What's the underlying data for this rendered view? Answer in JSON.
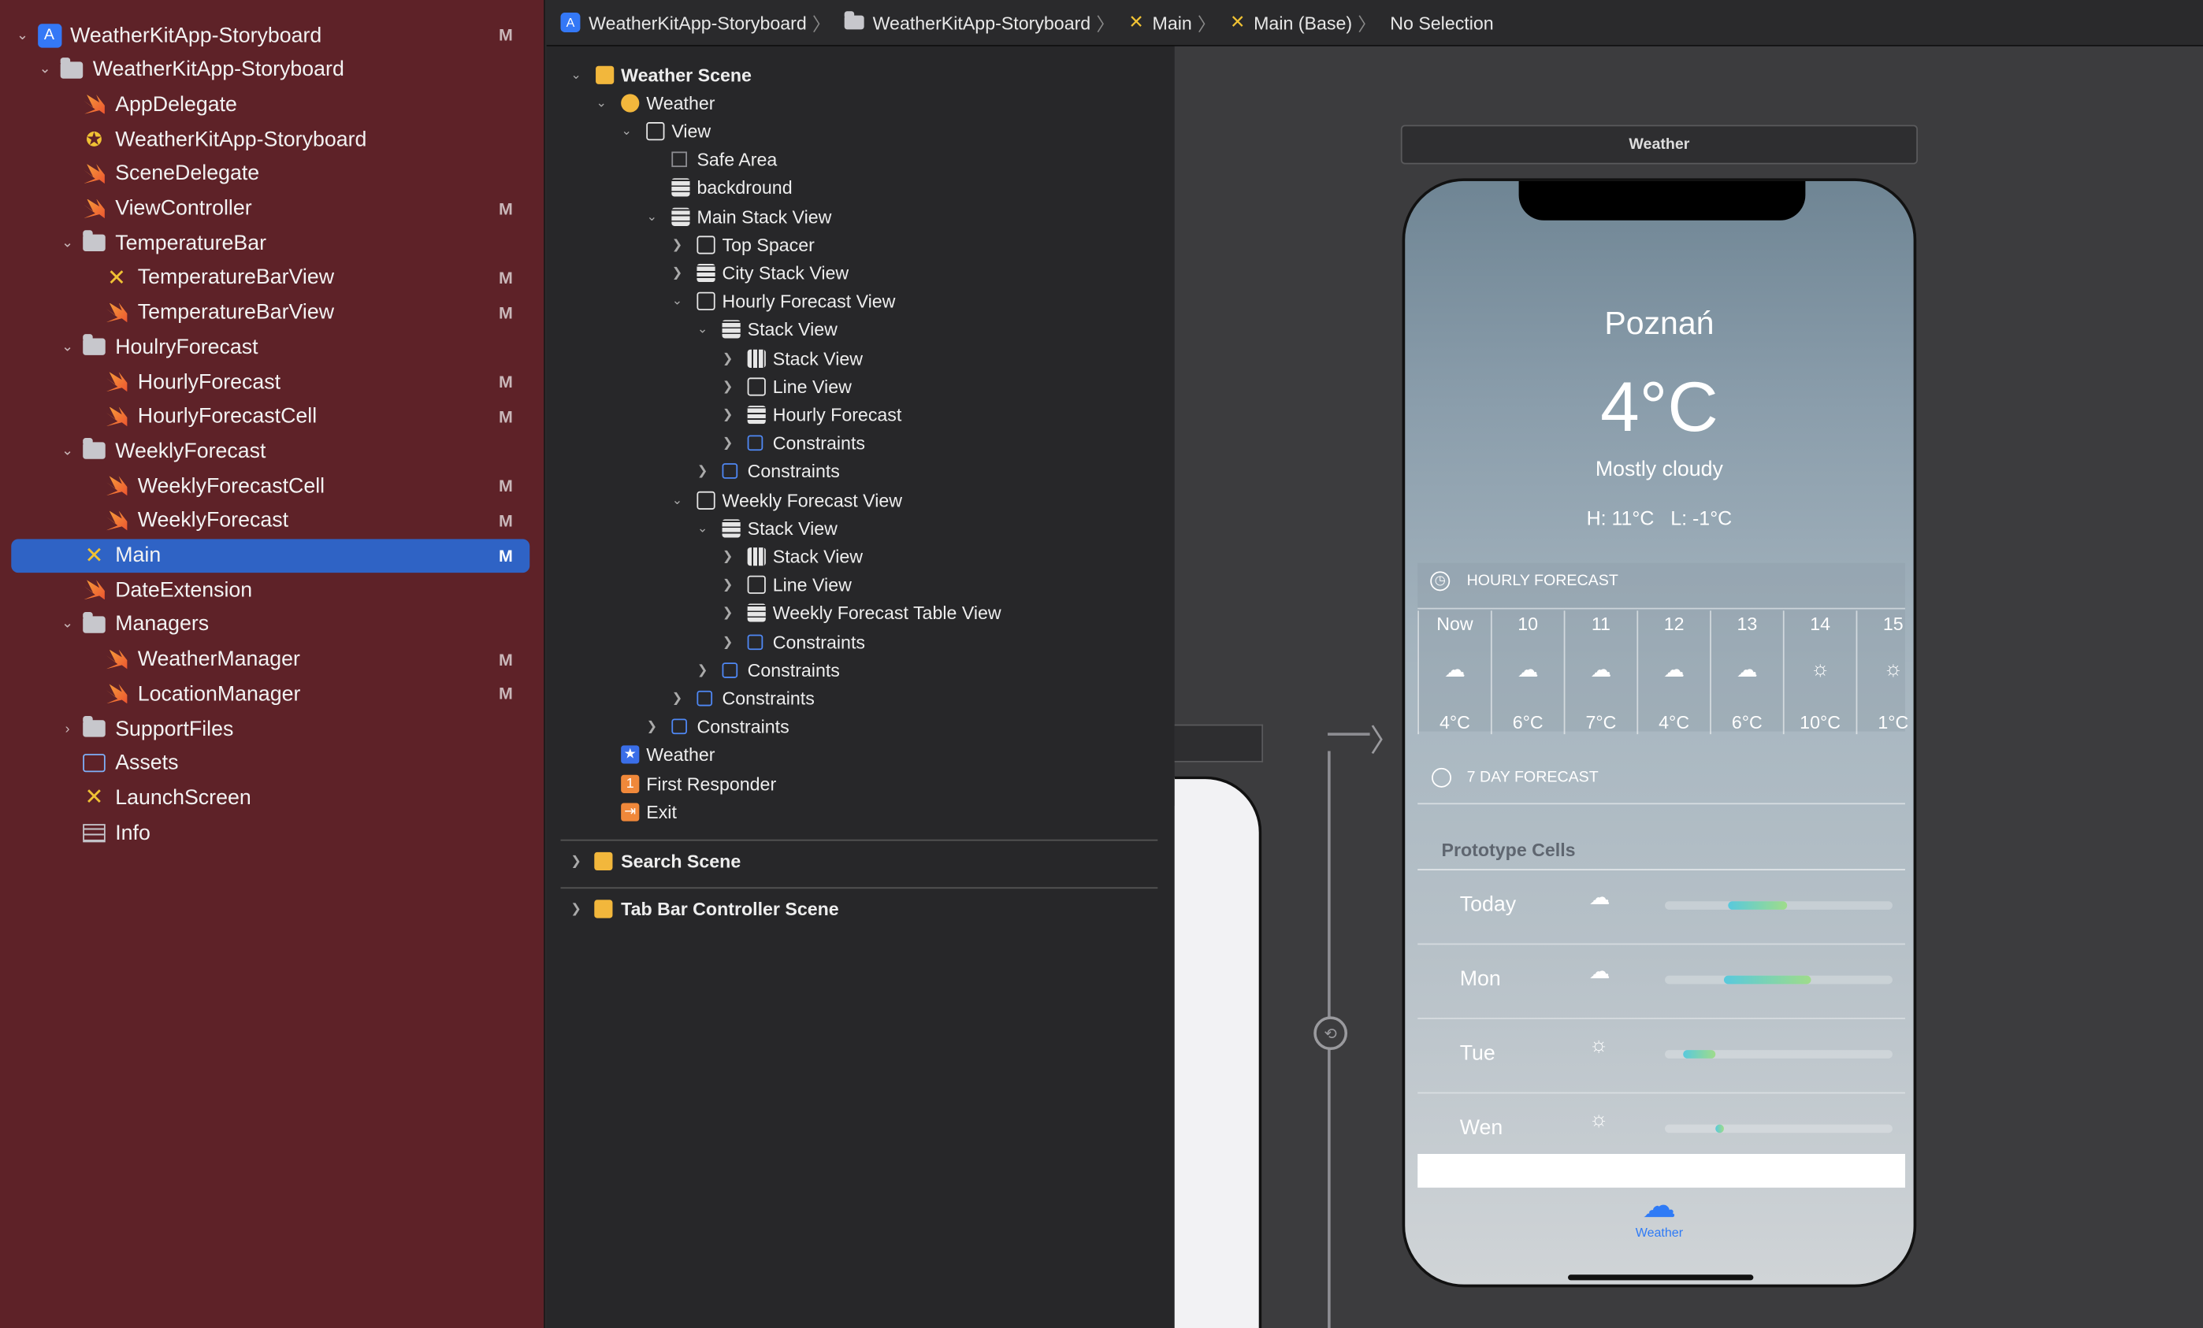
{
  "navigator": {
    "items": [
      {
        "label": "WeatherKitApp-Storyboard",
        "badge": "M",
        "icon": "project-icon"
      },
      {
        "label": "WeatherKitApp-Storyboard",
        "badge": "",
        "icon": "folder-icon"
      },
      {
        "label": "AppDelegate",
        "badge": "",
        "icon": "swift-file-icon"
      },
      {
        "label": "WeatherKitApp-Storyboard",
        "badge": "",
        "icon": "entitlements-icon"
      },
      {
        "label": "SceneDelegate",
        "badge": "",
        "icon": "swift-file-icon"
      },
      {
        "label": "ViewController",
        "badge": "M",
        "icon": "swift-file-icon"
      },
      {
        "label": "TemperatureBar",
        "badge": "",
        "icon": "folder-icon"
      },
      {
        "label": "TemperatureBarView",
        "badge": "M",
        "icon": "xib-icon"
      },
      {
        "label": "TemperatureBarView",
        "badge": "M",
        "icon": "swift-file-icon"
      },
      {
        "label": "HoulryForecast",
        "badge": "",
        "icon": "folder-icon"
      },
      {
        "label": "HourlyForecast",
        "badge": "M",
        "icon": "swift-file-icon"
      },
      {
        "label": "HourlyForecastCell",
        "badge": "M",
        "icon": "swift-file-icon"
      },
      {
        "label": "WeeklyForecast",
        "badge": "",
        "icon": "folder-icon"
      },
      {
        "label": "WeeklyForecastCell",
        "badge": "M",
        "icon": "swift-file-icon"
      },
      {
        "label": "WeeklyForecast",
        "badge": "M",
        "icon": "swift-file-icon"
      },
      {
        "label": "Main",
        "badge": "M",
        "icon": "storyboard-icon"
      },
      {
        "label": "DateExtension",
        "badge": "",
        "icon": "swift-file-icon"
      },
      {
        "label": "Managers",
        "badge": "",
        "icon": "folder-icon"
      },
      {
        "label": "WeatherManager",
        "badge": "M",
        "icon": "swift-file-icon"
      },
      {
        "label": "LocationManager",
        "badge": "M",
        "icon": "swift-file-icon"
      },
      {
        "label": "SupportFiles",
        "badge": "",
        "icon": "folder-icon"
      },
      {
        "label": "Assets",
        "badge": "",
        "icon": "assets-icon"
      },
      {
        "label": "LaunchScreen",
        "badge": "",
        "icon": "storyboard-icon"
      },
      {
        "label": "Info",
        "badge": "",
        "icon": "plist-icon"
      }
    ]
  },
  "breadcrumb": [
    "WeatherKitApp-Storyboard",
    "WeatherKitApp-Storyboard",
    "Main",
    "Main (Base)",
    "No Selection"
  ],
  "outline": {
    "items": [
      {
        "label": "Weather Scene"
      },
      {
        "label": "Weather"
      },
      {
        "label": "View"
      },
      {
        "label": "Safe Area"
      },
      {
        "label": "backdround"
      },
      {
        "label": "Main Stack View"
      },
      {
        "label": "Top Spacer"
      },
      {
        "label": "City Stack View"
      },
      {
        "label": "Hourly Forecast View"
      },
      {
        "label": "Stack View"
      },
      {
        "label": "Stack View"
      },
      {
        "label": "Line View"
      },
      {
        "label": "Hourly Forecast"
      },
      {
        "label": "Constraints"
      },
      {
        "label": "Constraints"
      },
      {
        "label": "Weekly Forecast View"
      },
      {
        "label": "Stack View"
      },
      {
        "label": "Stack View"
      },
      {
        "label": "Line View"
      },
      {
        "label": "Weekly Forecast Table View"
      },
      {
        "label": "Constraints"
      },
      {
        "label": "Constraints"
      },
      {
        "label": "Constraints"
      },
      {
        "label": "Constraints"
      },
      {
        "label": "Weather"
      },
      {
        "label": "First Responder"
      },
      {
        "label": "Exit"
      }
    ],
    "search_scene": "Search Scene",
    "tabbar_scene": "Tab Bar Controller Scene"
  },
  "canvas": {
    "scene_title": "Weather",
    "city": "Poznań",
    "temperature": "4°C",
    "condition": "Mostly cloudy",
    "high_low": "H: 11°C   L: -1°C",
    "hourly_header": "HOURLY FORECAST",
    "hourly": [
      {
        "time": "Now",
        "temp": "4°C",
        "icon": "cloud-drizzle-icon"
      },
      {
        "time": "10",
        "temp": "6°C",
        "icon": "cloud-drizzle-icon"
      },
      {
        "time": "11",
        "temp": "7°C",
        "icon": "cloud-drizzle-icon"
      },
      {
        "time": "12",
        "temp": "4°C",
        "icon": "cloud-icon"
      },
      {
        "time": "13",
        "temp": "6°C",
        "icon": "cloud-icon"
      },
      {
        "time": "14",
        "temp": "10°C",
        "icon": "sun-icon"
      },
      {
        "time": "15",
        "temp": "1°C",
        "icon": "sun-icon"
      }
    ],
    "weekly_header": "7 DAY FORECAST",
    "prototype_cells": "Prototype Cells",
    "days": [
      {
        "day": "Today",
        "icon": "cloud-rain-icon",
        "range": [
          0.28,
          0.54
        ]
      },
      {
        "day": "Mon",
        "icon": "cloud-rain-icon",
        "range": [
          0.26,
          0.64
        ]
      },
      {
        "day": "Tue",
        "icon": "sun-icon",
        "range": [
          0.08,
          0.22
        ]
      },
      {
        "day": "Wen",
        "icon": "sun-icon",
        "range": [
          0.22,
          0.26
        ]
      }
    ],
    "tab_label": "Weather"
  }
}
